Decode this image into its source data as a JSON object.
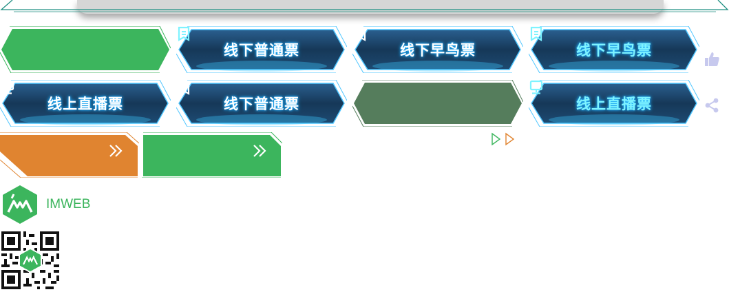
{
  "brand": {
    "name": "IMWEB",
    "color": "#3cb55d"
  },
  "colors": {
    "green": "#3cb55d",
    "dark_green": "#557d5c",
    "orange": "#e08430",
    "blue_dark": "#1b3e66",
    "cyan": "#7ef3ff"
  },
  "tickets": {
    "row1": [
      {
        "label": "",
        "style": "green"
      },
      {
        "label": "线下普通票",
        "icon": "ticket-icon",
        "style": "blue"
      },
      {
        "label": "线下早鸟票",
        "icon": "ticket-icon",
        "style": "blue"
      },
      {
        "label": "线下早鸟票",
        "icon": "ticket-icon",
        "style": "blue-cyan"
      }
    ],
    "row2": [
      {
        "label": "线上直播票",
        "icon": "monitor-icon",
        "style": "blue"
      },
      {
        "label": "线下普通票",
        "icon": "ticket-icon",
        "style": "blue"
      },
      {
        "label": "",
        "style": "dark-green"
      },
      {
        "label": "线上直播票",
        "icon": "monitor-icon",
        "style": "blue-cyan"
      }
    ]
  },
  "side_icons": [
    "thumbs-up-icon",
    "share-icon"
  ],
  "arrow_buttons": [
    {
      "style": "orange",
      "icon": "double-chevron-right-icon"
    },
    {
      "style": "green",
      "icon": "double-chevron-right-icon"
    }
  ]
}
